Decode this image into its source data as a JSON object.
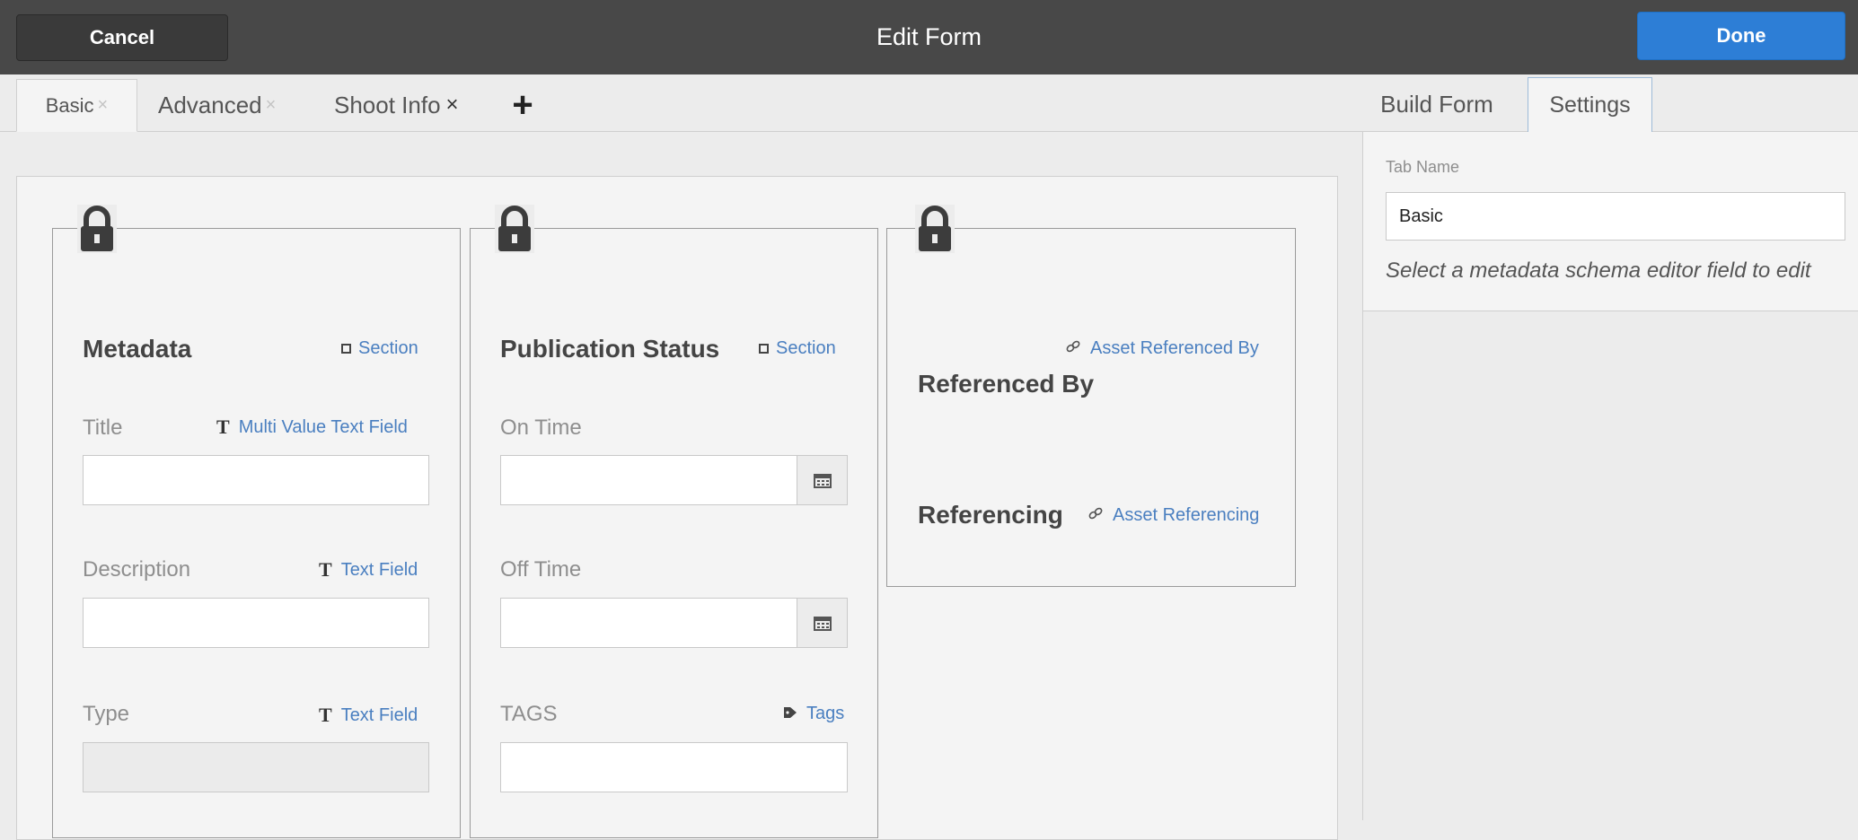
{
  "header": {
    "cancel_label": "Cancel",
    "title": "Edit Form",
    "done_label": "Done"
  },
  "tabs": [
    {
      "label": "Basic",
      "close": "×",
      "active": true
    },
    {
      "label": "Advanced",
      "close": "×"
    },
    {
      "label": "Shoot Info",
      "close": "×"
    }
  ],
  "add_tab_label": "+",
  "right_tabs": {
    "build_form": "Build Form",
    "settings": "Settings"
  },
  "columns": {
    "metadata": {
      "title": "Metadata",
      "section_link": "Section",
      "fields": [
        {
          "label": "Title",
          "type": "Multi Value Text Field"
        },
        {
          "label": "Description",
          "type": "Text Field"
        },
        {
          "label": "Type",
          "type": "Text Field"
        }
      ]
    },
    "publication": {
      "title": "Publication Status",
      "section_link": "Section",
      "fields": [
        {
          "label": "On Time"
        },
        {
          "label": "Off Time"
        },
        {
          "label": "TAGS",
          "type": "Tags"
        }
      ]
    },
    "references": {
      "referenced_by_link": "Asset Referenced By",
      "referenced_by_title": "Referenced By",
      "referencing_title": "Referencing",
      "referencing_link": "Asset Referencing"
    }
  },
  "settings": {
    "tab_name_label": "Tab Name",
    "tab_name_value": "Basic",
    "hint": "Select a metadata schema editor field to edit"
  },
  "icons": [
    "lock-icon",
    "section-square-icon",
    "text-field-icon",
    "calendar-icon",
    "link-icon",
    "tag-icon",
    "plus-icon",
    "close-icon"
  ],
  "colors": {
    "topbar": "#484848",
    "done": "#2d7ed6",
    "link": "#4a7fc0"
  }
}
